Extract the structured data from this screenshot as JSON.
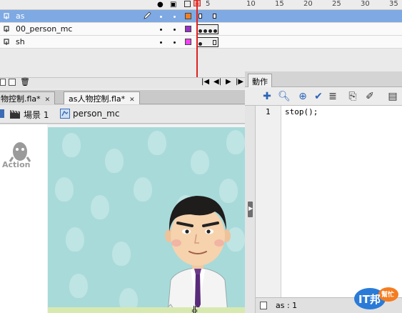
{
  "timeline": {
    "frame_ticks": [
      "1",
      "5",
      "10",
      "15",
      "20",
      "25",
      "30",
      "35"
    ],
    "current_frame": 1,
    "layers": [
      {
        "name": "as",
        "color": "#f08020",
        "selected": true
      },
      {
        "name": "00_person_mc",
        "color": "#9b30c8",
        "selected": false
      },
      {
        "name": "sh",
        "color": "#f040f0",
        "selected": false
      }
    ]
  },
  "document_tabs": [
    {
      "label": "物控制.fla*",
      "active": false
    },
    {
      "label": "as人物控制.fla*",
      "active": true
    }
  ],
  "breadcrumb": {
    "scene": "場景 1",
    "symbol": "person_mc"
  },
  "stage": {
    "sidebar_label": "Action",
    "background_color": "#a8dada"
  },
  "actions_panel": {
    "title": "動作",
    "lines": [
      {
        "number": "1",
        "code": "stop();"
      }
    ],
    "status_tab": "as : 1",
    "toolbar_icons": [
      "add-icon",
      "find-icon",
      "target-icon",
      "check-icon",
      "format-icon",
      "code-hint-icon",
      "debug-icon",
      "snippets-icon"
    ]
  },
  "watermark": {
    "brand": "IT邦",
    "sub": "幫忙"
  }
}
